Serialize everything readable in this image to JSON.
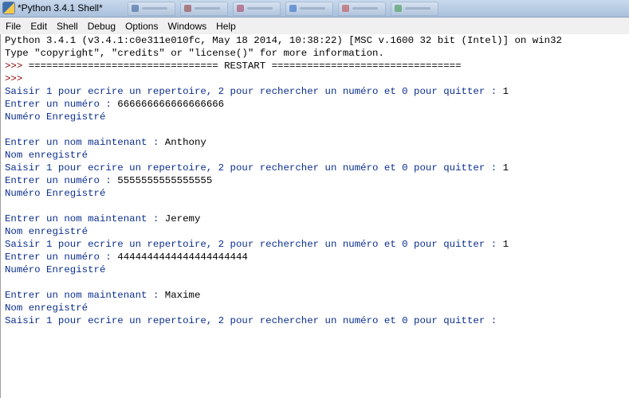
{
  "window": {
    "title": "*Python 3.4.1 Shell*"
  },
  "menu": [
    {
      "label": "File"
    },
    {
      "label": "Edit"
    },
    {
      "label": "Shell"
    },
    {
      "label": "Debug"
    },
    {
      "label": "Options"
    },
    {
      "label": "Windows"
    },
    {
      "label": "Help"
    }
  ],
  "console": {
    "lines": [
      {
        "kind": "stdout",
        "prefix": "",
        "text": "Python 3.4.1 (v3.4.1:c0e311e010fc, May 18 2014, 10:38:22) [MSC v.1600 32 bit (Intel)] on win32"
      },
      {
        "kind": "stdout",
        "prefix": "",
        "text": "Type \"copyright\", \"credits\" or \"license()\" for more information."
      },
      {
        "kind": "prompt",
        "prefix": ">>> ",
        "text": "================================ RESTART ================================"
      },
      {
        "kind": "prompt",
        "prefix": ">>> ",
        "text": ""
      },
      {
        "kind": "stdin",
        "prefix": "",
        "text": "Saisir 1 pour ecrire un repertoire, 2 pour rechercher un numéro et 0 pour quitter : ",
        "user": "1"
      },
      {
        "kind": "stdin",
        "prefix": "",
        "text": "Entrer un numéro : ",
        "user": "666666666666666666"
      },
      {
        "kind": "stdin",
        "prefix": "",
        "text": "Numéro Enregistré",
        "user": ""
      },
      {
        "kind": "empty"
      },
      {
        "kind": "stdin",
        "prefix": "",
        "text": "Entrer un nom maintenant : ",
        "user": "Anthony"
      },
      {
        "kind": "stdin",
        "prefix": "",
        "text": "Nom enregistré",
        "user": ""
      },
      {
        "kind": "stdin",
        "prefix": "",
        "text": "Saisir 1 pour ecrire un repertoire, 2 pour rechercher un numéro et 0 pour quitter : ",
        "user": "1"
      },
      {
        "kind": "stdin",
        "prefix": "",
        "text": "Entrer un numéro : ",
        "user": "5555555555555555"
      },
      {
        "kind": "stdin",
        "prefix": "",
        "text": "Numéro Enregistré",
        "user": ""
      },
      {
        "kind": "empty"
      },
      {
        "kind": "stdin",
        "prefix": "",
        "text": "Entrer un nom maintenant : ",
        "user": "Jeremy"
      },
      {
        "kind": "stdin",
        "prefix": "",
        "text": "Nom enregistré",
        "user": ""
      },
      {
        "kind": "stdin",
        "prefix": "",
        "text": "Saisir 1 pour ecrire un repertoire, 2 pour rechercher un numéro et 0 pour quitter : ",
        "user": "1"
      },
      {
        "kind": "stdin",
        "prefix": "",
        "text": "Entrer un numéro : ",
        "user": "4444444444444444444444"
      },
      {
        "kind": "stdin",
        "prefix": "",
        "text": "Numéro Enregistré",
        "user": ""
      },
      {
        "kind": "empty"
      },
      {
        "kind": "stdin",
        "prefix": "",
        "text": "Entrer un nom maintenant : ",
        "user": "Maxime"
      },
      {
        "kind": "stdin",
        "prefix": "",
        "text": "Nom enregistré",
        "user": ""
      },
      {
        "kind": "stdin",
        "prefix": "",
        "text": "Saisir 1 pour ecrire un repertoire, 2 pour rechercher un numéro et 0 pour quitter : ",
        "user": ""
      }
    ]
  },
  "colors": {
    "stdout": "#000000",
    "prompt": "#8b0000",
    "stdin_output": "#0b2f8f"
  }
}
